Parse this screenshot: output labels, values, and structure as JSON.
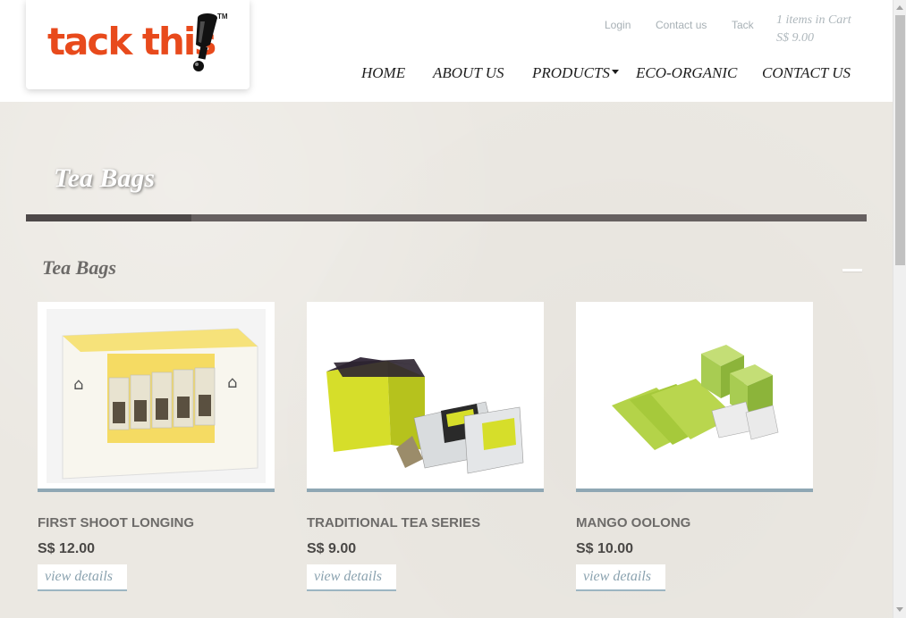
{
  "brand": {
    "logo_text": "tack this",
    "tm": "TM"
  },
  "top_links": {
    "login": "Login",
    "contact": "Contact us",
    "tack": "Tack"
  },
  "cart": {
    "items": "1 items in Cart",
    "total": "S$  9.00"
  },
  "nav": {
    "home": "HOME",
    "about": "ABOUT US",
    "products": "PRODUCTS",
    "eco": "ECO-ORGANIC",
    "contact": "CONTACT US"
  },
  "page": {
    "title": "Tea Bags",
    "section_title": "Tea Bags"
  },
  "products": [
    {
      "name": "FIRST SHOOT LONGING",
      "price": "S$ 12.00",
      "details": "view details"
    },
    {
      "name": "TRADITIONAL TEA SERIES",
      "price": "S$ 9.00",
      "details": "view details"
    },
    {
      "name": "MANGO OOLONG",
      "price": "S$ 10.00",
      "details": "view details"
    }
  ],
  "colors": {
    "brand_orange": "#e84a1c",
    "accent_blue": "#8fa7b4",
    "bar_dark": "#666060"
  }
}
